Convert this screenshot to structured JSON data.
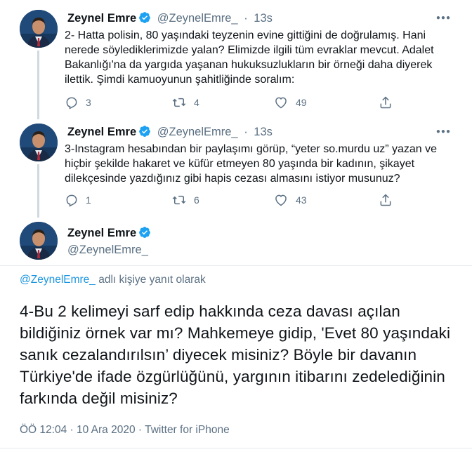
{
  "tweets": [
    {
      "name": "Zeynel Emre",
      "handle": "@ZeynelEmre_",
      "dot": "·",
      "time": "13s",
      "text": "2- Hatta polisin, 80 yaşındaki teyzenin evine gittiğini de doğrulamış. Hani nerede söylediklerimizde yalan? Elimizde ilgili tüm evraklar mevcut. Adalet Bakanlığı'na da yargıda yaşanan hukuksuzlukların bir örneği daha diyerek ilettik. Şimdi kamuoyunun şahitliğinde soralım:",
      "replies": "3",
      "retweets": "4",
      "likes": "49"
    },
    {
      "name": "Zeynel Emre",
      "handle": "@ZeynelEmre_",
      "dot": "·",
      "time": "13s",
      "text": "3-Instagram hesabından bir paylaşımı görüp, “yeter so.murdu uz” yazan ve hiçbir şekilde hakaret ve küfür etmeyen 80 yaşında bir kadının, şikayet dilekçesinde yazdığınız gibi hapis cezası almasını istiyor musunuz?",
      "replies": "1",
      "retweets": "6",
      "likes": "43"
    }
  ],
  "main_tweet": {
    "name": "Zeynel Emre",
    "handle": "@ZeynelEmre_",
    "replying_link": "@ZeynelEmre_",
    "replying_suffix": " adlı kişiye yanıt olarak",
    "text": "4-Bu 2 kelimeyi sarf edip hakkında ceza davası açılan bildiğiniz örnek var mı? Mahkemeye gidip, 'Evet 80 yaşındaki sanık cezalandırılsın’ diyecek misiniz? Böyle bir davanın Türkiye'de ifade özgürlüğünü, yargının itibarını zedelediğinin farkında değil misiniz?",
    "timestamp": "ÖÖ 12:04 · 10 Ara 2020 · Twitter for iPhone"
  },
  "icons": {
    "reply": "reply-icon",
    "retweet": "retweet-icon",
    "like": "heart-icon",
    "share": "share-icon",
    "verified": "verified-badge-icon",
    "more": "more-icon"
  },
  "colors": {
    "accent": "#1b95e0",
    "verified": "#1da1f2",
    "muted": "#5b7083",
    "text": "#0f1419"
  }
}
